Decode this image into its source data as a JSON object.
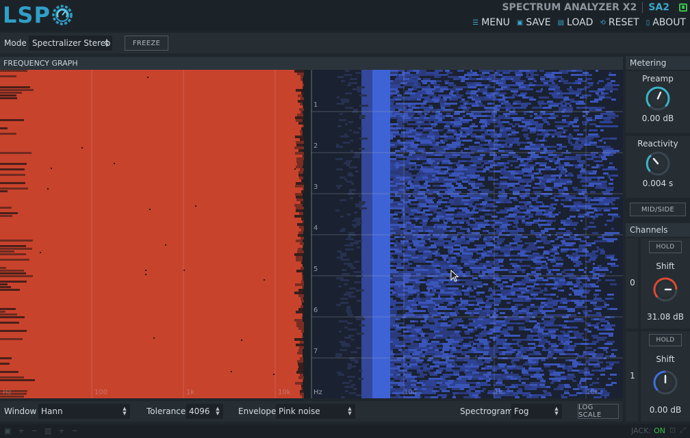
{
  "header": {
    "logo_text": "LSP",
    "plugin_title": "SPECTRUM ANALYZER X2",
    "plugin_short": "SA2"
  },
  "menu": {
    "items": [
      {
        "label": "MENU",
        "icon": "menu-icon"
      },
      {
        "label": "SAVE",
        "icon": "save-icon"
      },
      {
        "label": "LOAD",
        "icon": "load-icon"
      },
      {
        "label": "RESET",
        "icon": "reset-icon"
      },
      {
        "label": "ABOUT",
        "icon": "about-icon"
      }
    ]
  },
  "toolbar": {
    "mode_label": "Mode",
    "mode_value": "Spectralizer Stereo",
    "freeze_label": "FREEZE"
  },
  "graph": {
    "title": "FREQUENCY GRAPH",
    "row_labels": [
      "1",
      "2",
      "3",
      "4",
      "5",
      "6",
      "7"
    ],
    "freq_labels_left": [
      "Hz",
      "100",
      "1k",
      "10k"
    ],
    "freq_labels_right": [
      "Hz",
      "100",
      "1k",
      "10k"
    ]
  },
  "bottom": {
    "window_label": "Window",
    "window_value": "Hann",
    "tolerance_label": "Tolerance",
    "tolerance_value": "4096",
    "envelope_label": "Envelope",
    "envelope_value": "Pink noise",
    "spectrogram_label": "Spectrogram",
    "spectrogram_value": "Fog",
    "logscale_label": "LOG SCALE"
  },
  "metering": {
    "title": "Metering",
    "preamp_label": "Preamp",
    "preamp_value": "0.00 dB",
    "reactivity_label": "Reactivity",
    "reactivity_value": "0.004 s",
    "midside_label": "MID/SIDE"
  },
  "channels": {
    "title": "Channels",
    "items": [
      {
        "num": "0",
        "hold_label": "HOLD",
        "shift_label": "Shift",
        "shift_value": "31.08 dB",
        "color": "#e0492f"
      },
      {
        "num": "1",
        "hold_label": "HOLD",
        "shift_label": "Shift",
        "shift_value": "0.00 dB",
        "color": "#3e6fe0"
      }
    ]
  },
  "status": {
    "jack_label": "JACK:",
    "jack_state": "ON"
  },
  "colors": {
    "accent": "#3ba7c9",
    "left_channel": "#c8432c",
    "right_channel": "#3e63d6",
    "led_on": "#3bbf4a"
  }
}
